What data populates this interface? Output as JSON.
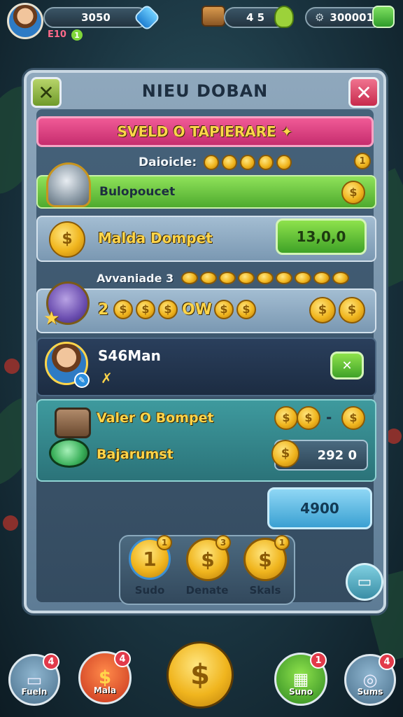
{
  "topbar": {
    "coins": "3050",
    "level": "E10",
    "level_badge": "1",
    "chest_count": "4 5",
    "gems": "300001"
  },
  "panel": {
    "title": "NIEU DOBAN",
    "banner": "SVELD O TAPIERARE ✦",
    "daily_label": "Daioicle:",
    "daily_badge": "1",
    "row1_label": "Bulopoucet",
    "row2_label": "Malda Dompet",
    "row2_value": "13,0,0",
    "advance_label": "Avvaniade 3",
    "row3_label": "2",
    "row3_text": "OW",
    "player_name": "S46Man",
    "player_sub": "✗",
    "row5_label": "Valer O Bompet",
    "row5_dash": "-",
    "row6_label": "Bajarumst",
    "row6_value": "292 0",
    "total_value": "4900",
    "rewards": [
      {
        "label": "Sudo",
        "glyph": "1",
        "badge": "1"
      },
      {
        "label": "Denate",
        "glyph": "$",
        "badge": "3"
      },
      {
        "label": "Skals",
        "glyph": "$",
        "badge": "1"
      }
    ]
  },
  "nav": [
    {
      "label": "Fueln",
      "badge": "4"
    },
    {
      "label": "Mala",
      "badge": "4"
    },
    {
      "label": "",
      "badge": ""
    },
    {
      "label": "Suno",
      "badge": "1"
    },
    {
      "label": "Sums",
      "badge": "4"
    }
  ],
  "colors": {
    "accent_green": "#5cc23a",
    "accent_pink": "#e0356a",
    "gold": "#f0b51e"
  }
}
